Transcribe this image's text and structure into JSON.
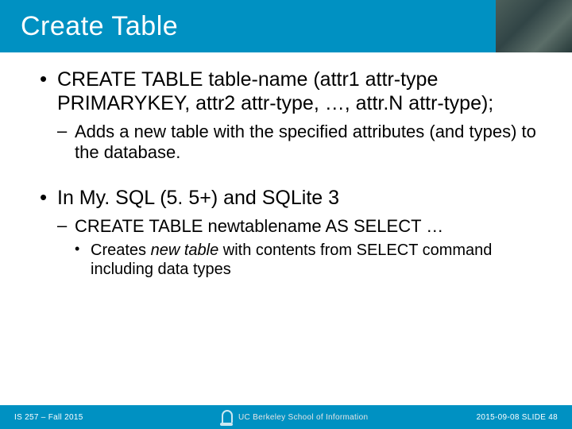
{
  "slide": {
    "title": "Create Table",
    "bullets": [
      {
        "text": "CREATE TABLE table-name (attr1 attr-type PRIMARYKEY, attr2 attr-type, …, attr.N attr-type);",
        "sub": [
          {
            "text": "Adds a new table with the specified attributes (and types) to the database."
          }
        ]
      },
      {
        "text": "In My. SQL (5. 5+) and SQLite 3",
        "sub": [
          {
            "text": "CREATE TABLE newtablename AS SELECT …",
            "sub": [
              {
                "text_prefix": "Creates ",
                "text_italic": "new table",
                "text_suffix": " with contents from SELECT command including data types"
              }
            ]
          }
        ]
      }
    ]
  },
  "footer": {
    "left": "IS 257 – Fall 2015",
    "center": "UC Berkeley School of Information",
    "right": "2015-09-08  SLIDE 48"
  }
}
